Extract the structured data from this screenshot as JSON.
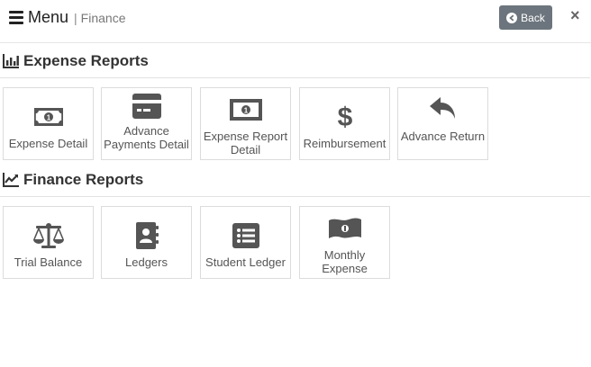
{
  "header": {
    "menu_label": "Menu",
    "separator": "|",
    "breadcrumb": "Finance",
    "back_label": "Back",
    "close_label": "×"
  },
  "sections": [
    {
      "title": "Expense Reports",
      "icon": "bar-chart-icon",
      "tiles": [
        {
          "label": "Expense Detail",
          "icon": "money-bill-icon"
        },
        {
          "label": "Advance Payments Detail",
          "icon": "credit-card-icon"
        },
        {
          "label": "Expense Report Detail",
          "icon": "money-bill-alt-icon"
        },
        {
          "label": "Reimbursement",
          "icon": "dollar-sign-icon"
        },
        {
          "label": "Advance Return",
          "icon": "reply-arrow-icon"
        }
      ]
    },
    {
      "title": "Finance Reports",
      "icon": "line-chart-icon",
      "tiles": [
        {
          "label": "Trial Balance",
          "icon": "balance-scale-icon"
        },
        {
          "label": "Ledgers",
          "icon": "address-book-icon"
        },
        {
          "label": "Student Ledger",
          "icon": "list-alt-icon"
        },
        {
          "label": "Monthly Expense",
          "icon": "money-bill-wave-icon"
        }
      ]
    }
  ]
}
